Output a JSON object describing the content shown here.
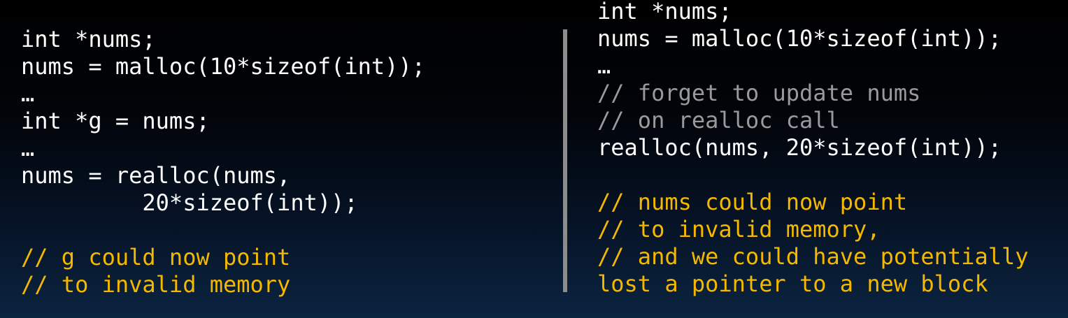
{
  "left_panel": {
    "lines": [
      {
        "text": "int *nums;",
        "style": "code"
      },
      {
        "text": "nums = malloc(10*sizeof(int));",
        "style": "code"
      },
      {
        "text": "…",
        "style": "code"
      },
      {
        "text": "int *g = nums;",
        "style": "code"
      },
      {
        "text": "…",
        "style": "code"
      },
      {
        "text": "nums = realloc(nums,",
        "style": "code"
      },
      {
        "text": "         20*sizeof(int));",
        "style": "code"
      },
      {
        "text": "",
        "style": "blank"
      },
      {
        "text": "// g could now point",
        "style": "highlight-comment"
      },
      {
        "text": "// to invalid memory",
        "style": "highlight-comment"
      }
    ]
  },
  "right_panel": {
    "lines": [
      {
        "text": "int *nums;",
        "style": "code"
      },
      {
        "text": "nums = malloc(10*sizeof(int));",
        "style": "code"
      },
      {
        "text": "…",
        "style": "code"
      },
      {
        "text": "// forget to update nums",
        "style": "comment"
      },
      {
        "text": "// on realloc call",
        "style": "comment"
      },
      {
        "text": "realloc(nums, 20*sizeof(int));",
        "style": "code"
      },
      {
        "text": "",
        "style": "blank"
      },
      {
        "text": "// nums could now point",
        "style": "highlight-comment"
      },
      {
        "text": "// to invalid memory,",
        "style": "highlight-comment"
      },
      {
        "text": "// and we could have potentially",
        "style": "highlight-comment"
      },
      {
        "text": "lost a pointer to a new block",
        "style": "highlight-comment"
      }
    ]
  },
  "colors": {
    "code": "#ffffff",
    "comment": "#9a9a9a",
    "highlight_comment": "#f5b800",
    "divider": "#8c8c8c"
  }
}
